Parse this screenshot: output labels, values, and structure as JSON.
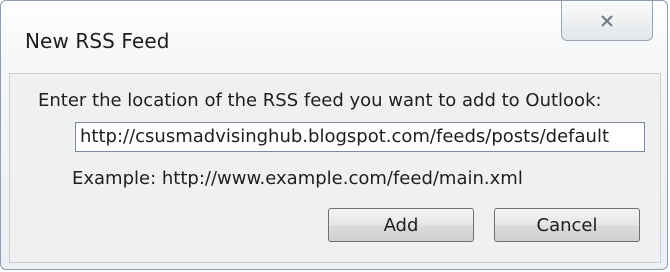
{
  "window": {
    "title": "New RSS Feed",
    "close_icon": "close-icon"
  },
  "form": {
    "prompt": "Enter the location of the RSS feed you want to add to Outlook:",
    "url_value": "http://csusmadvisinghub.blogspot.com/feeds/posts/default",
    "example": "Example: http://www.example.com/feed/main.xml"
  },
  "buttons": {
    "add_label": "Add",
    "cancel_label": "Cancel"
  }
}
